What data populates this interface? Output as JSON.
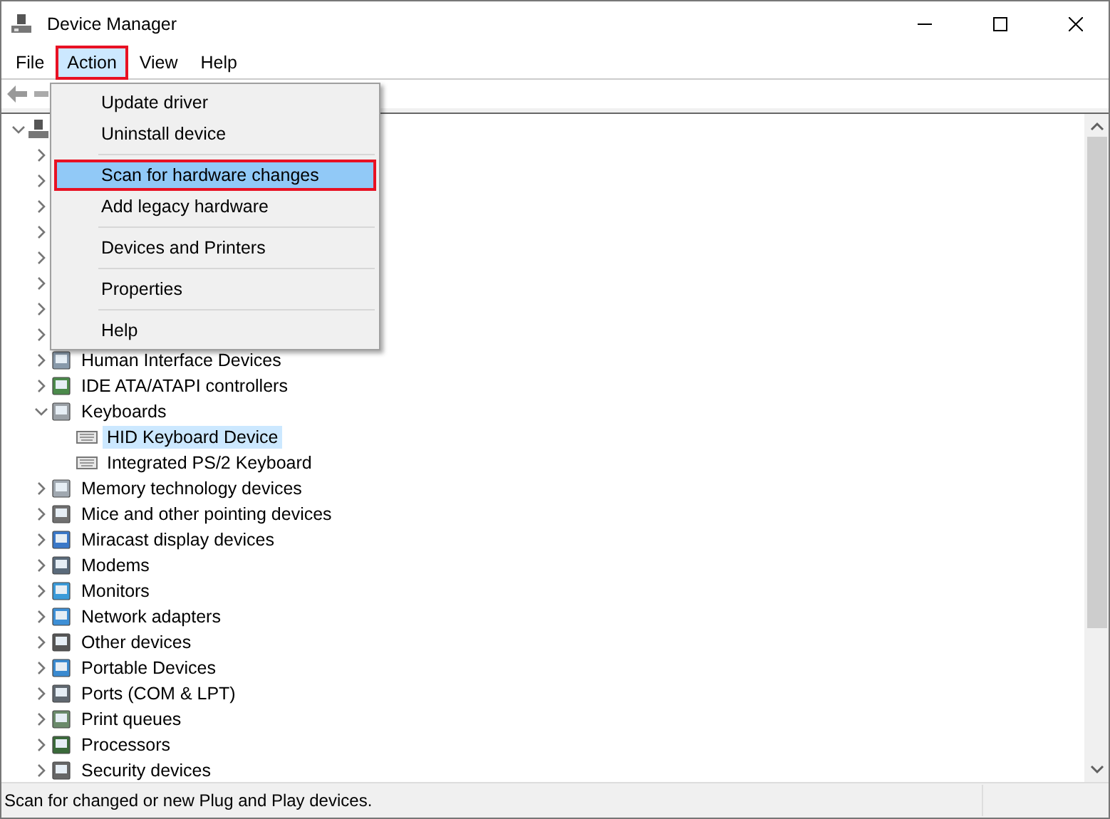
{
  "window": {
    "title": "Device Manager"
  },
  "menubar": [
    {
      "label": "File",
      "selected": false,
      "highlighted": false
    },
    {
      "label": "Action",
      "selected": true,
      "highlighted": true
    },
    {
      "label": "View",
      "selected": false,
      "highlighted": false
    },
    {
      "label": "Help",
      "selected": false,
      "highlighted": false
    }
  ],
  "action_menu": [
    {
      "kind": "item",
      "label": "Update driver",
      "selected": false,
      "highlighted": false
    },
    {
      "kind": "item",
      "label": "Uninstall device",
      "selected": false,
      "highlighted": false
    },
    {
      "kind": "separator"
    },
    {
      "kind": "item",
      "label": "Scan for hardware changes",
      "selected": true,
      "highlighted": true
    },
    {
      "kind": "item",
      "label": "Add legacy hardware",
      "selected": false,
      "highlighted": false
    },
    {
      "kind": "separator"
    },
    {
      "kind": "item",
      "label": "Devices and Printers",
      "selected": false,
      "highlighted": false
    },
    {
      "kind": "separator"
    },
    {
      "kind": "item",
      "label": "Properties",
      "selected": false,
      "highlighted": false
    },
    {
      "kind": "separator"
    },
    {
      "kind": "item",
      "label": "Help",
      "selected": false,
      "highlighted": false
    }
  ],
  "tree": {
    "expanded": true,
    "children": [
      {
        "expanded": false
      },
      {
        "expanded": false
      },
      {
        "expanded": false
      },
      {
        "expanded": false
      },
      {
        "expanded": false
      },
      {
        "expanded": false
      },
      {
        "expanded": false
      },
      {
        "expanded": false
      },
      {
        "label": "Human Interface Devices",
        "expanded": false
      },
      {
        "label": "IDE ATA/ATAPI controllers",
        "expanded": false
      },
      {
        "label": "Keyboards",
        "expanded": true,
        "children": [
          {
            "label": "HID Keyboard Device",
            "selected": true
          },
          {
            "label": "Integrated PS/2 Keyboard",
            "selected": false
          }
        ]
      },
      {
        "label": "Memory technology devices",
        "expanded": false
      },
      {
        "label": "Mice and other pointing devices",
        "expanded": false
      },
      {
        "label": "Miracast display devices",
        "expanded": false
      },
      {
        "label": "Modems",
        "expanded": false
      },
      {
        "label": "Monitors",
        "expanded": false
      },
      {
        "label": "Network adapters",
        "expanded": false
      },
      {
        "label": "Other devices",
        "expanded": false
      },
      {
        "label": "Portable Devices",
        "expanded": false
      },
      {
        "label": "Ports (COM & LPT)",
        "expanded": false
      },
      {
        "label": "Print queues",
        "expanded": false
      },
      {
        "label": "Processors",
        "expanded": false
      },
      {
        "label": "Security devices",
        "expanded": false
      }
    ]
  },
  "status_bar": {
    "text": "Scan for changed or new Plug and Play devices."
  }
}
